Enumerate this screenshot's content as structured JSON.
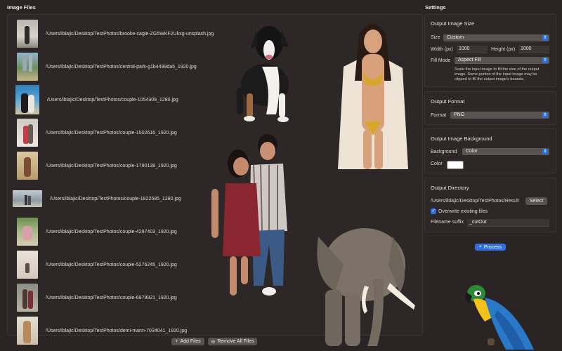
{
  "files_panel": {
    "title": "Image Files"
  },
  "settings_panel": {
    "title": "Settings"
  },
  "files": [
    {
      "path": "/Users/iblajic/Desktop/TestPhotos/brooke-cagle-ZG5WKF2Ukxg-unsplash.jpg"
    },
    {
      "path": "/Users/iblajic/Desktop/TestPhotos/central-park-g1b4499da5_1920.jpg"
    },
    {
      "path": "/Users/iblajic/Desktop/TestPhotos/couple-1054309_1280.jpg"
    },
    {
      "path": "/Users/iblajic/Desktop/TestPhotos/couple-1502616_1920.jpg"
    },
    {
      "path": "/Users/iblajic/Desktop/TestPhotos/couple-1790138_1920.jpg"
    },
    {
      "path": "/Users/iblajic/Desktop/TestPhotos/couple-1822585_1280.jpg"
    },
    {
      "path": "/Users/iblajic/Desktop/TestPhotos/couple-4297403_1920.jpg"
    },
    {
      "path": "/Users/iblajic/Desktop/TestPhotos/couple-5276245_1920.jpg"
    },
    {
      "path": "/Users/iblajic/Desktop/TestPhotos/couple-6979921_1920.jpg"
    },
    {
      "path": "/Users/iblajic/Desktop/TestPhotos/demi-mann-7034041_1920.jpg"
    }
  ],
  "toolbar": {
    "add_files": "Add Files",
    "add_icon": "+",
    "remove_all": "Remove All Files",
    "remove_icon": "⊖"
  },
  "output_size": {
    "title": "Output Image Size",
    "size_label": "Size",
    "size_value": "Custom",
    "width_label": "Width (px)",
    "width_value": "1000",
    "height_label": "Height (px)",
    "height_value": "1000",
    "fill_label": "Fill Mode",
    "fill_value": "Aspect Fill",
    "help_line1": "Scale the input image to fill the size of the output",
    "help_line2": "image. Some portion of the input image may be",
    "help_line3": "clipped to fill the output image's bounds."
  },
  "output_format": {
    "title": "Output Format",
    "format_label": "Format",
    "format_value": "PNG"
  },
  "output_background": {
    "title": "Output Image Background",
    "background_label": "Background",
    "background_value": "Color",
    "color_label": "Color",
    "color_value": "#ffffff"
  },
  "output_directory": {
    "title": "Output Directory",
    "path": "/Users/iblajic/Desktop/TestPhotos/Result",
    "select_label": "Select",
    "overwrite_label": "Overwrite existing files",
    "overwrite_checked": true,
    "suffix_label": "Filename suffix",
    "suffix_value": "_cutOut"
  },
  "process": {
    "label": "Process",
    "icon": "wand-icon"
  },
  "colors": {
    "accent": "#2f6fe0",
    "background": "#2a2524",
    "panel": "#2d2827"
  }
}
